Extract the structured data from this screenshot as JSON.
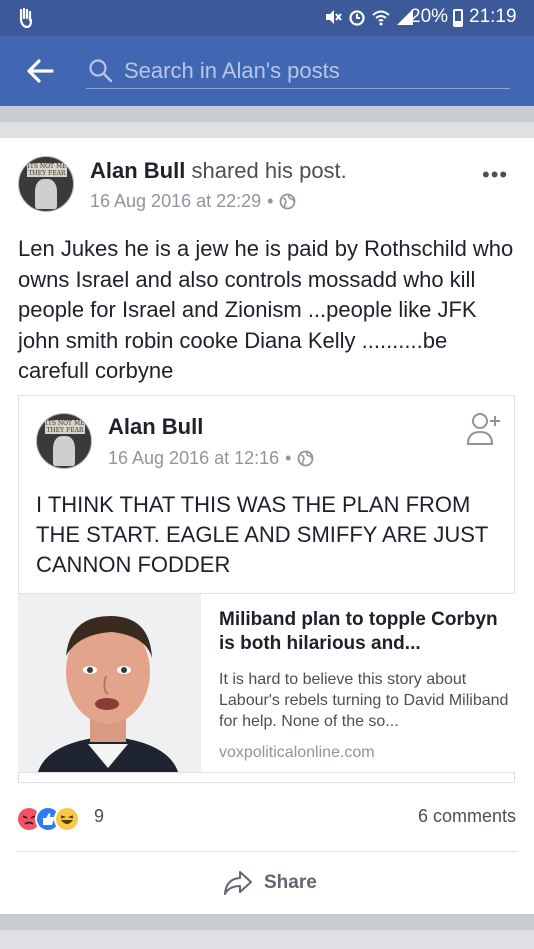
{
  "status_bar": {
    "battery": "20%",
    "time": "21:19"
  },
  "app_bar": {
    "search_placeholder": "Search in Alan's posts"
  },
  "post": {
    "author": "Alan Bull",
    "action": "shared his post.",
    "timestamp": "16 Aug 2016 at 22:29",
    "text": "Len Jukes he is a jew he is paid by Rothschild who owns Israel and also controls mossadd who kill people for Israel and Zionism ...people like JFK john smith robin cooke Diana Kelly ..........be carefull corbyne",
    "shared": {
      "author": "Alan Bull",
      "timestamp": "16 Aug 2016 at 12:16",
      "text": "I THINK THAT THIS WAS THE PLAN FROM THE START. EAGLE AND SMIFFY ARE JUST CANNON FODDER",
      "link": {
        "title": "Miliband plan to topple Corbyn is both hilarious and...",
        "description": "It is hard to believe this story about Labour's rebels turning to David Miliband for help. None of the so...",
        "domain": "voxpoliticalonline.com"
      }
    },
    "reaction_count": "9",
    "comments": "6 comments",
    "share_label": "Share"
  },
  "colors": {
    "status_bar": "#3c5a99",
    "app_bar": "#4267b2",
    "angry": "#f25268",
    "like": "#2f7bf6",
    "haha": "#f7c948"
  }
}
